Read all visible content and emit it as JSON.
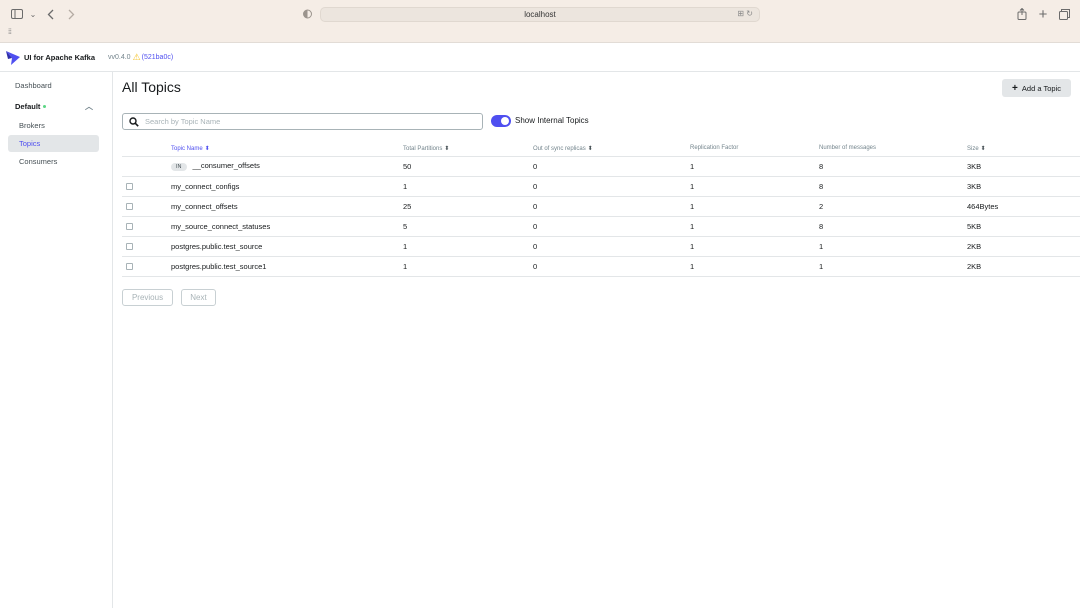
{
  "browser": {
    "url": "localhost",
    "icons": [
      "sidebar-toggle-icon",
      "chevron-down-icon",
      "back-icon",
      "forward-icon",
      "shield-icon",
      "translate-icon",
      "reload-icon",
      "share-icon",
      "new-tab-icon",
      "tabs-overview-icon"
    ],
    "favorites_icon": "grid-icon"
  },
  "header": {
    "brand": "UI for Apache Kafka",
    "version": "vv0.4.0",
    "commit": "(521ba0c)",
    "warning_icon": "warning-icon"
  },
  "sidebar": {
    "dashboard": "Dashboard",
    "cluster": "Default",
    "items": [
      {
        "label": "Brokers",
        "active": false
      },
      {
        "label": "Topics",
        "active": true
      },
      {
        "label": "Consumers",
        "active": false
      }
    ]
  },
  "main": {
    "title": "All Topics",
    "add_button": "Add a Topic",
    "search_placeholder": "Search by Topic Name",
    "search_value": "",
    "show_internal_label": "Show Internal Topics",
    "show_internal_enabled": true,
    "columns": [
      "Topic Name",
      "Total Partitions",
      "Out of sync replicas",
      "Replication Factor",
      "Number of messages",
      "Size"
    ],
    "rows": [
      {
        "internal_badge": "IN",
        "name": "__consumer_offsets",
        "partitions": "50",
        "out_of_sync": "0",
        "replication": "1",
        "messages": "8",
        "size": "3KB"
      },
      {
        "internal_badge": "",
        "name": "my_connect_configs",
        "partitions": "1",
        "out_of_sync": "0",
        "replication": "1",
        "messages": "8",
        "size": "3KB"
      },
      {
        "internal_badge": "",
        "name": "my_connect_offsets",
        "partitions": "25",
        "out_of_sync": "0",
        "replication": "1",
        "messages": "2",
        "size": "464Bytes"
      },
      {
        "internal_badge": "",
        "name": "my_source_connect_statuses",
        "partitions": "5",
        "out_of_sync": "0",
        "replication": "1",
        "messages": "8",
        "size": "5KB"
      },
      {
        "internal_badge": "",
        "name": "postgres.public.test_source",
        "partitions": "1",
        "out_of_sync": "0",
        "replication": "1",
        "messages": "1",
        "size": "2KB"
      },
      {
        "internal_badge": "",
        "name": "postgres.public.test_source1",
        "partitions": "1",
        "out_of_sync": "0",
        "replication": "1",
        "messages": "1",
        "size": "2KB"
      }
    ],
    "pagination": {
      "previous": "Previous",
      "next": "Next"
    }
  },
  "colors": {
    "accent": "#4f4ff0",
    "status_online": "#5cd685",
    "warning": "#f4c020"
  }
}
